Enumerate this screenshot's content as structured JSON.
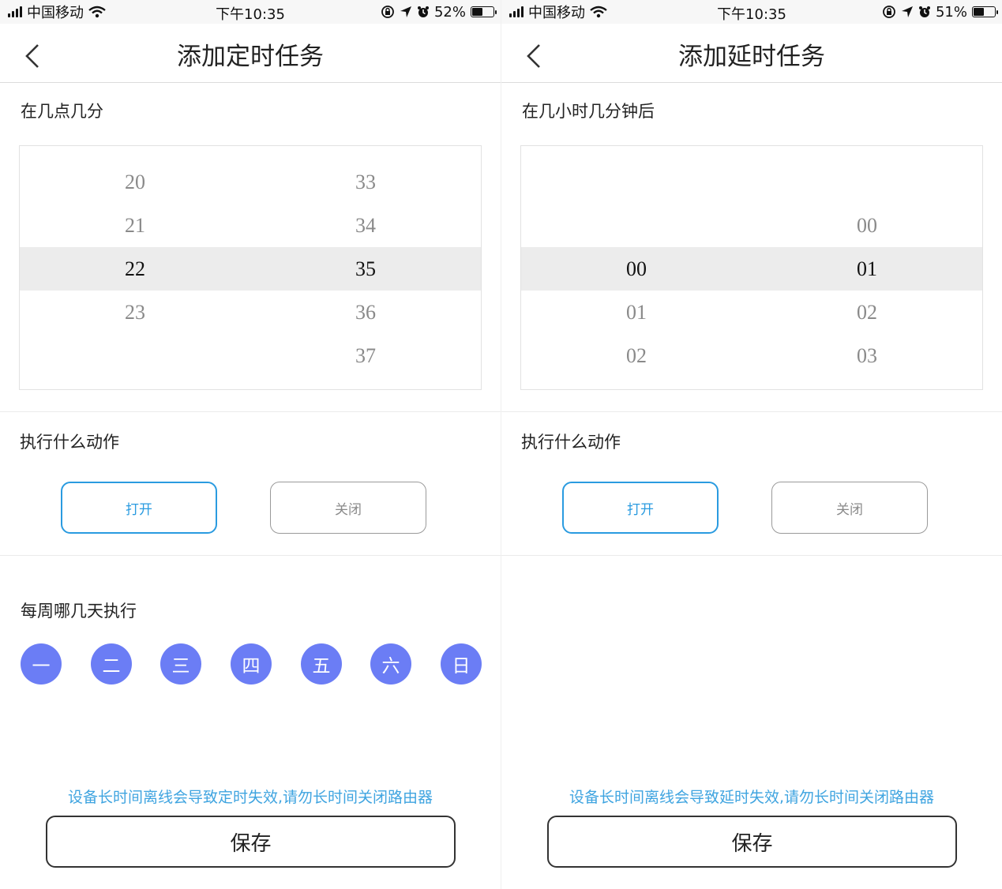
{
  "left": {
    "status": {
      "carrier": "中国移动",
      "time": "下午10:35",
      "battery": "52%",
      "battery_level": 0.52
    },
    "title": "添加定时任务",
    "time_label": "在几点几分",
    "picker_hours": [
      "20",
      "21",
      "22",
      "23",
      ""
    ],
    "picker_minutes": [
      "33",
      "34",
      "35",
      "36",
      "37"
    ],
    "selected_index": 2,
    "action_label": "执行什么动作",
    "action_on": "打开",
    "action_off": "关闭",
    "weekday_label": "每周哪几天执行",
    "weekdays": [
      "一",
      "二",
      "三",
      "四",
      "五",
      "六",
      "日"
    ],
    "warning": "设备长时间离线会导致定时失效,请勿长时间关闭路由器",
    "save": "保存"
  },
  "right": {
    "status": {
      "carrier": "中国移动",
      "time": "下午10:35",
      "battery": "51%",
      "battery_level": 0.51
    },
    "title": "添加延时任务",
    "time_label": "在几小时几分钟后",
    "picker_hours": [
      "",
      "",
      "00",
      "01",
      "02"
    ],
    "picker_minutes": [
      "",
      "00",
      "01",
      "02",
      "03"
    ],
    "selected_index": 2,
    "action_label": "执行什么动作",
    "action_on": "打开",
    "action_off": "关闭",
    "warning": "设备长时间离线会导致延时失效,请勿长时间关闭路由器",
    "save": "保存"
  },
  "colors": {
    "accent_blue": "#2a9be0",
    "day_circle": "#6b7df5",
    "warning_text": "#3fa4e0"
  },
  "icons": [
    "signal-icon",
    "wifi-icon",
    "lock-rotation-icon",
    "location-icon",
    "alarm-icon",
    "battery-icon",
    "back-chevron-icon"
  ]
}
